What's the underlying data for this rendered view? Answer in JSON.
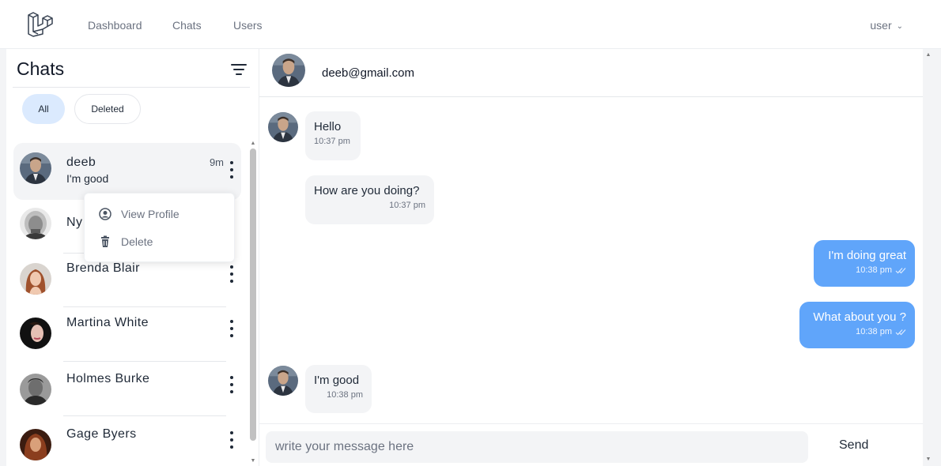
{
  "nav": {
    "links": [
      "Dashboard",
      "Chats",
      "Users"
    ],
    "user_label": "user"
  },
  "sidebar": {
    "title": "Chats",
    "filters": [
      "All",
      "Deleted"
    ],
    "active_filter": "All",
    "chats": [
      {
        "name": "deeb",
        "preview": "I'm good",
        "time": "9m",
        "active": true
      },
      {
        "name": "Ny",
        "preview": "",
        "time": ""
      },
      {
        "name": "Brenda Blair",
        "preview": "",
        "time": ""
      },
      {
        "name": "Martina White",
        "preview": "",
        "time": ""
      },
      {
        "name": "Holmes Burke",
        "preview": "",
        "time": ""
      },
      {
        "name": "Gage Byers",
        "preview": "",
        "time": ""
      }
    ],
    "context_menu": {
      "view_profile": "View Profile",
      "delete": "Delete"
    }
  },
  "conversation": {
    "contact": "deeb@gmail.com",
    "messages": [
      {
        "text": "Hello",
        "time": "10:37 pm",
        "direction": "in"
      },
      {
        "text": "How are you doing?",
        "time": "10:37 pm",
        "direction": "in"
      },
      {
        "text": "I'm doing great",
        "time": "10:38 pm",
        "direction": "out"
      },
      {
        "text": "What about you ?",
        "time": "10:38 pm",
        "direction": "out"
      },
      {
        "text": "I'm good",
        "time": "10:38 pm",
        "direction": "in"
      }
    ],
    "input_placeholder": "write your message here",
    "send_label": "Send"
  },
  "colors": {
    "accent": "#60a5fa",
    "active_pill": "#dbeafe",
    "incoming_bubble": "#f3f4f6"
  }
}
